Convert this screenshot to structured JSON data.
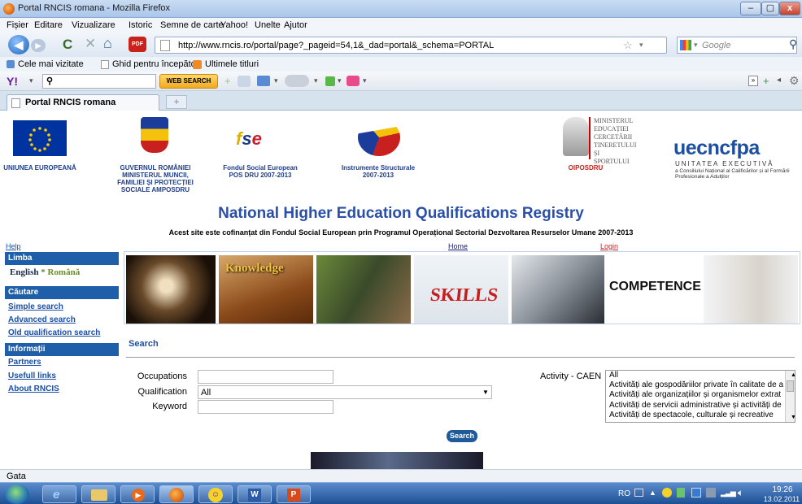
{
  "window": {
    "title": "Portal RNCIS romana - Mozilla Firefox",
    "min": "–",
    "max": "▢",
    "close": "x"
  },
  "menu": [
    "Fișier",
    "Editare",
    "Vizualizare",
    "Istoric",
    "Semne de carte",
    "Yahoo!",
    "Unelte",
    "Ajutor"
  ],
  "nav": {
    "url": "http://www.rncis.ro/portal/page?_pageid=54,1&_dad=portal&_schema=PORTAL",
    "search_placeholder": "Google",
    "pdf_label": "PDF"
  },
  "bookmarks": [
    "Cele mai vizitate",
    "Ghid pentru începători",
    "Ultimele titluri"
  ],
  "yahoo": {
    "logo": "Y!",
    "web_search": "WEB SEARCH"
  },
  "tab": {
    "title": "Portal RNCIS romana",
    "new": "+"
  },
  "logos": {
    "eu": "UNIUNEA EUROPEANĂ",
    "gov": "GUVERNUL ROMÂNIEI MINISTERUL MUNCII, FAMILIEI ȘI PROTECȚIEI SOCIALE AMPOSDRU",
    "fse": "Fondul Social European POS DRU 2007-2013",
    "is": "Instrumente Structurale 2007-2013",
    "oi": "OIPOSDRU",
    "ministry": "MINISTERUL EDUCAȚIEI CERCETĂRII TINERETULUI ȘI SPORTULUI",
    "cncfpa": "uecncfpa",
    "cncfpa_sub1": "UNITATEA EXECUTIVĂ",
    "cncfpa_sub2": "a Consiliului Național al Calificărilor și al Formării Profesionale a Adulților"
  },
  "site": {
    "title": "National Higher Education Qualifications Registry",
    "subtitle": "Acest site este cofinanțat din Fondul Social European prin Programul Operațional Sectorial Dezvoltarea Resurselor Umane 2007-2013",
    "help": "Help",
    "home": "Home",
    "login": "Login"
  },
  "sidebar": {
    "lang_head": "Limba",
    "english": "English",
    "sep": "*",
    "romana": "Română",
    "search_head": "Căutare",
    "simple": "Simple search",
    "advanced": "Advanced search",
    "old": "Old qualification search",
    "info_head": "Informații",
    "partners": "Partners",
    "links": "Usefull links",
    "about": "About RNCIS"
  },
  "banner": {
    "knowledge": "Knowledge",
    "skills": "SKILLS",
    "competence": "COMPETENCE"
  },
  "search": {
    "heading": "Search",
    "occupations": "Occupations",
    "qualification": "Qualification",
    "qualification_value": "All",
    "keyword": "Keyword",
    "activity": "Activity - CAEN",
    "caen": [
      "All",
      "Activități ale gospodăriilor private în calitate de a",
      "Activități ale organizațiilor și organismelor extrat",
      "Activități de servicii administrative și activități de",
      "Activități de spectacole, culturale și recreative"
    ],
    "button": "Search"
  },
  "status": "Gata",
  "tray": {
    "lang": "RO",
    "time": "19:26",
    "date": "13.02.2011"
  }
}
